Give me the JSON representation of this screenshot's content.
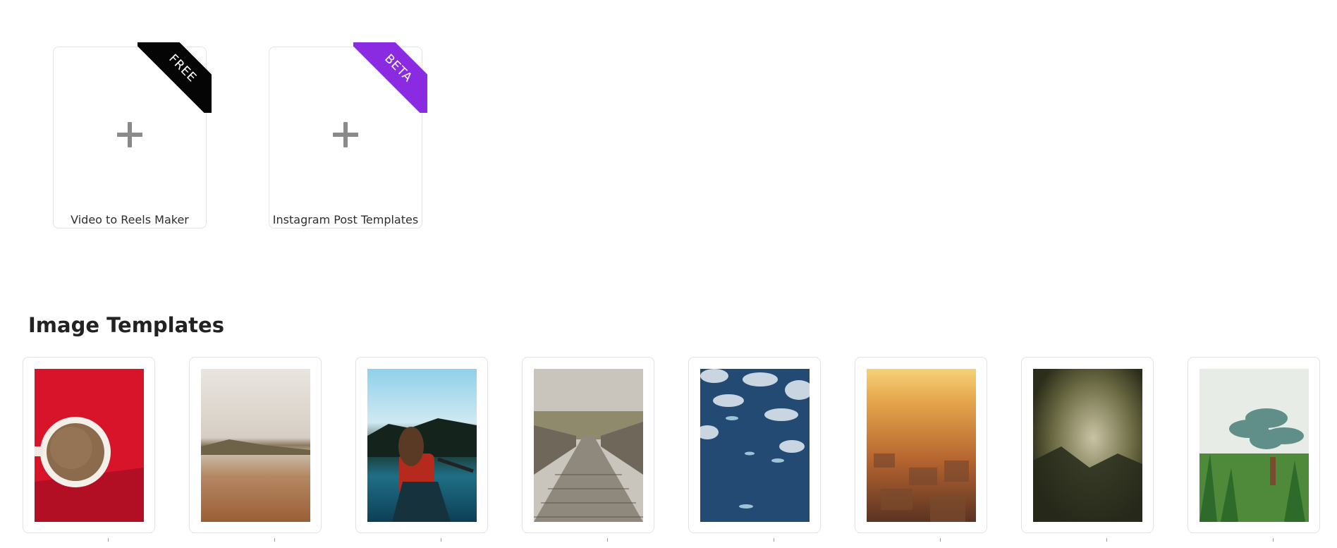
{
  "create_cards": [
    {
      "label": "Video to Reels Maker",
      "badge": "FREE",
      "badge_color": "#050505",
      "icon": "plus-icon"
    },
    {
      "label": "Instagram Post Templates",
      "badge": "BETA",
      "badge_color": "#8a2be2",
      "icon": "plus-icon"
    }
  ],
  "image_templates": {
    "title": "Image Templates",
    "items": [
      {
        "thumbnail": "coffee-cup-on-red"
      },
      {
        "thumbnail": "beach-shore-cloudy-sky"
      },
      {
        "thumbnail": "woman-in-canoe-on-lake"
      },
      {
        "thumbnail": "wooden-boardwalk"
      },
      {
        "thumbnail": "fish-in-blue-water"
      },
      {
        "thumbnail": "city-rooftops-sunset"
      },
      {
        "thumbnail": "misty-forest"
      },
      {
        "thumbnail": "succulent-plant"
      }
    ]
  },
  "colors": {
    "accent_purple": "#8a2be2",
    "badge_black": "#050505",
    "plus_gray": "#8a8a8a"
  }
}
